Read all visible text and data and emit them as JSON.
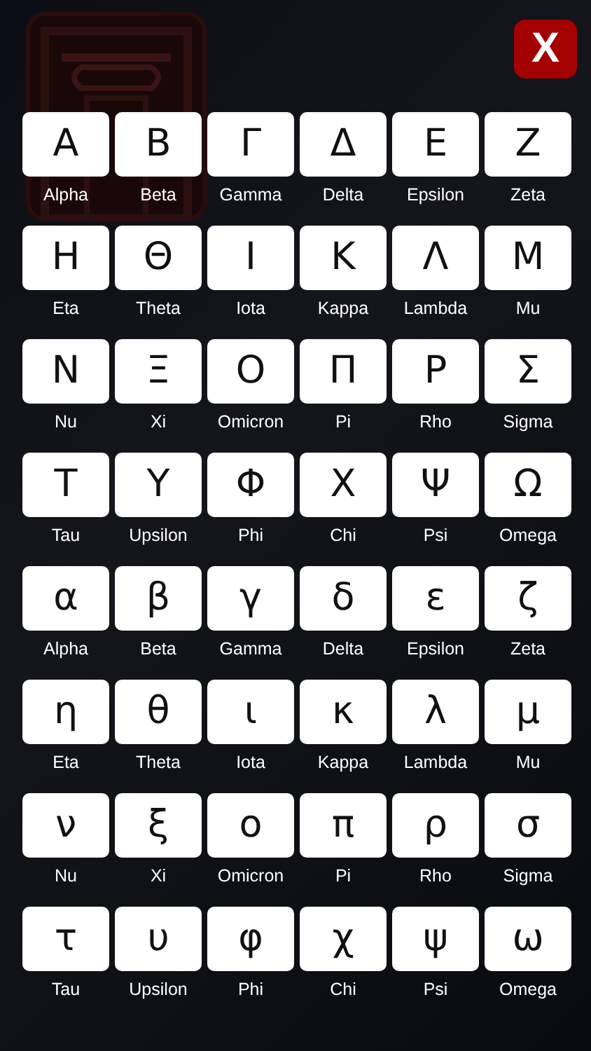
{
  "close_button": {
    "label": "X"
  },
  "letters": [
    {
      "symbol": "Α",
      "name": "Alpha"
    },
    {
      "symbol": "Β",
      "name": "Beta"
    },
    {
      "symbol": "Γ",
      "name": "Gamma"
    },
    {
      "symbol": "Δ",
      "name": "Delta"
    },
    {
      "symbol": "Ε",
      "name": "Epsilon"
    },
    {
      "symbol": "Ζ",
      "name": "Zeta"
    },
    {
      "symbol": "Η",
      "name": "Eta"
    },
    {
      "symbol": "Θ",
      "name": "Theta"
    },
    {
      "symbol": "Ι",
      "name": "Iota"
    },
    {
      "symbol": "Κ",
      "name": "Kappa"
    },
    {
      "symbol": "Λ",
      "name": "Lambda"
    },
    {
      "symbol": "Μ",
      "name": "Mu"
    },
    {
      "symbol": "Ν",
      "name": "Nu"
    },
    {
      "symbol": "Ξ",
      "name": "Xi"
    },
    {
      "symbol": "Ο",
      "name": "Omicron"
    },
    {
      "symbol": "Π",
      "name": "Pi"
    },
    {
      "symbol": "Ρ",
      "name": "Rho"
    },
    {
      "symbol": "Σ",
      "name": "Sigma"
    },
    {
      "symbol": "Τ",
      "name": "Tau"
    },
    {
      "symbol": "Υ",
      "name": "Upsilon"
    },
    {
      "symbol": "Φ",
      "name": "Phi"
    },
    {
      "symbol": "Χ",
      "name": "Chi"
    },
    {
      "symbol": "Ψ",
      "name": "Psi"
    },
    {
      "symbol": "Ω",
      "name": "Omega"
    },
    {
      "symbol": "α",
      "name": "Alpha"
    },
    {
      "symbol": "β",
      "name": "Beta"
    },
    {
      "symbol": "γ",
      "name": "Gamma"
    },
    {
      "symbol": "δ",
      "name": "Delta"
    },
    {
      "symbol": "ε",
      "name": "Epsilon"
    },
    {
      "symbol": "ζ",
      "name": "Zeta"
    },
    {
      "symbol": "η",
      "name": "Eta"
    },
    {
      "symbol": "θ",
      "name": "Theta"
    },
    {
      "symbol": "ι",
      "name": "Iota"
    },
    {
      "symbol": "κ",
      "name": "Kappa"
    },
    {
      "symbol": "λ",
      "name": "Lambda"
    },
    {
      "symbol": "μ",
      "name": "Mu"
    },
    {
      "symbol": "ν",
      "name": "Nu"
    },
    {
      "symbol": "ξ",
      "name": "Xi"
    },
    {
      "symbol": "ο",
      "name": "Omicron"
    },
    {
      "symbol": "π",
      "name": "Pi"
    },
    {
      "symbol": "ρ",
      "name": "Rho"
    },
    {
      "symbol": "σ",
      "name": "Sigma"
    },
    {
      "symbol": "τ",
      "name": "Tau"
    },
    {
      "symbol": "υ",
      "name": "Upsilon"
    },
    {
      "symbol": "φ",
      "name": "Phi"
    },
    {
      "symbol": "χ",
      "name": "Chi"
    },
    {
      "symbol": "ψ",
      "name": "Psi"
    },
    {
      "symbol": "ω",
      "name": "Omega"
    }
  ]
}
